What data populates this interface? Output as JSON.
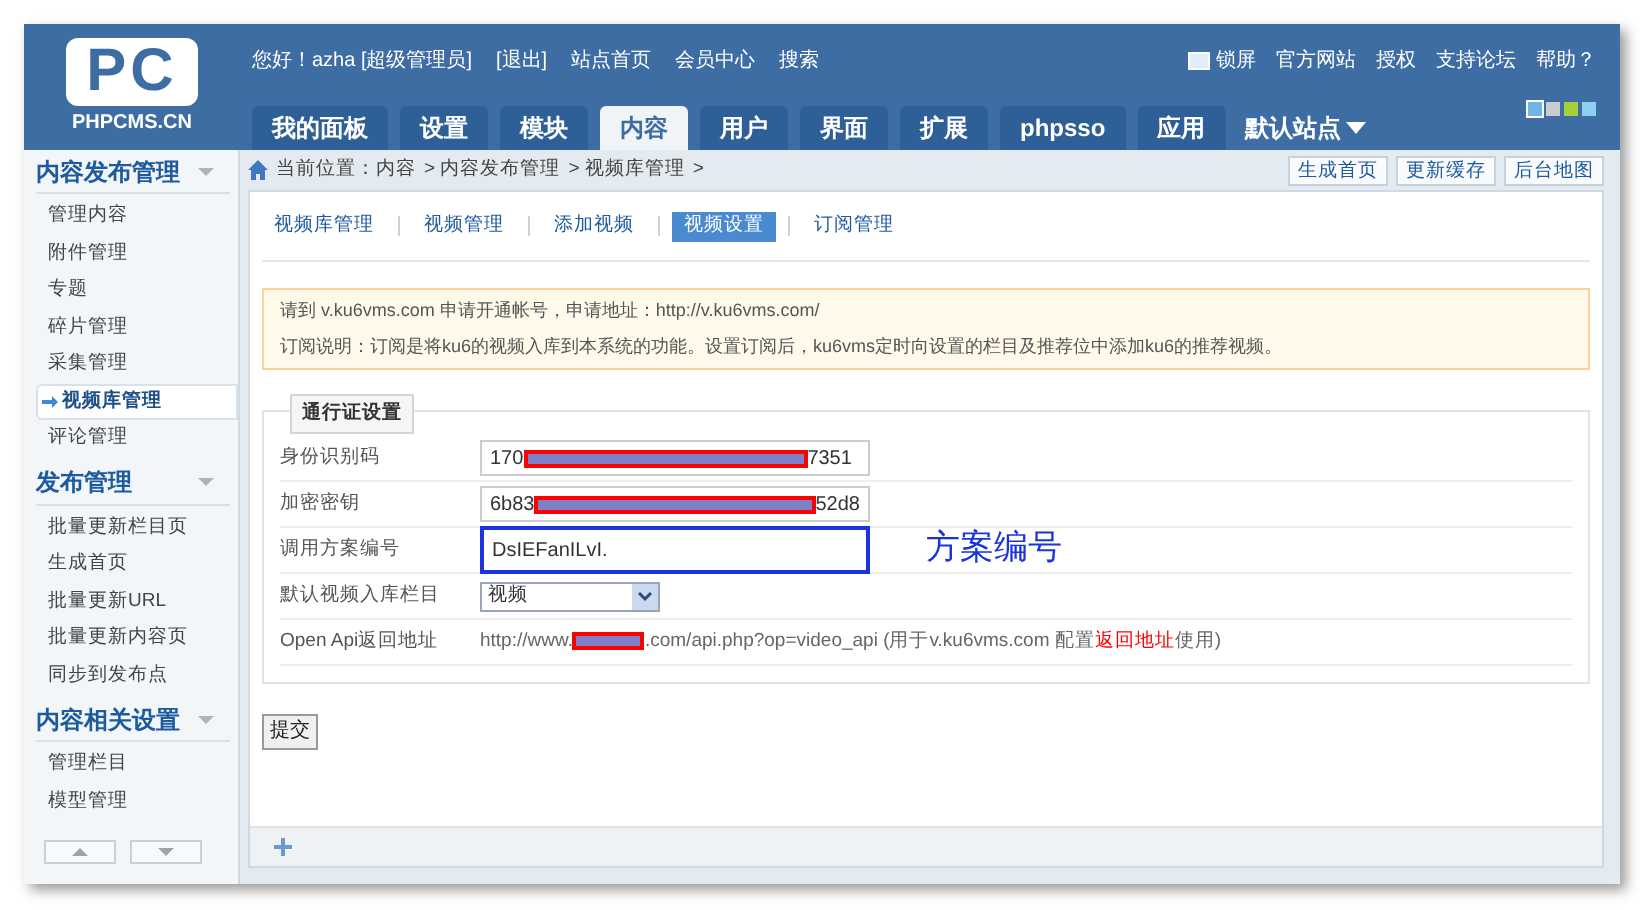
{
  "logo": {
    "letters": "PC",
    "site": "PHPCMS.CN"
  },
  "top_links": [
    "您好！azha [超级管理员]",
    "[退出]",
    "站点首页",
    "会员中心",
    "搜索"
  ],
  "right_links": [
    "锁屏",
    "官方网站",
    "授权",
    "支持论坛",
    "帮助？"
  ],
  "tabs": [
    {
      "label": "我的面板",
      "selected": false
    },
    {
      "label": "设置",
      "selected": false
    },
    {
      "label": "模块",
      "selected": false
    },
    {
      "label": "内容",
      "selected": true
    },
    {
      "label": "用户",
      "selected": false
    },
    {
      "label": "界面",
      "selected": false
    },
    {
      "label": "扩展",
      "selected": false
    },
    {
      "label": "phpsso",
      "selected": false
    },
    {
      "label": "应用",
      "selected": false
    }
  ],
  "site_menu": "默认站点",
  "themes": [
    {
      "color": "#6fb3e8",
      "selected": true
    },
    {
      "color": "#c9cdd2",
      "selected": false
    },
    {
      "color": "#a6cf3c",
      "selected": false
    },
    {
      "color": "#8fd0f0",
      "selected": false
    }
  ],
  "sidebar": [
    {
      "title": "内容发布管理",
      "items": [
        {
          "label": "管理内容",
          "selected": false
        },
        {
          "label": "附件管理",
          "selected": false
        },
        {
          "label": "专题",
          "selected": false
        },
        {
          "label": "碎片管理",
          "selected": false
        },
        {
          "label": "采集管理",
          "selected": false
        },
        {
          "label": "视频库管理",
          "selected": true
        },
        {
          "label": "评论管理",
          "selected": false
        }
      ]
    },
    {
      "title": "发布管理",
      "items": [
        {
          "label": "批量更新栏目页",
          "selected": false
        },
        {
          "label": "生成首页",
          "selected": false
        },
        {
          "label": "批量更新URL",
          "selected": false
        },
        {
          "label": "批量更新内容页",
          "selected": false
        },
        {
          "label": "同步到发布点",
          "selected": false
        }
      ]
    },
    {
      "title": "内容相关设置",
      "items": [
        {
          "label": "管理栏目",
          "selected": false
        },
        {
          "label": "模型管理",
          "selected": false
        }
      ]
    }
  ],
  "breadcrumb": [
    "当前位置：内容",
    "> 内容发布管理",
    "> 视频库管理",
    "> "
  ],
  "header_buttons": [
    "生成首页",
    "更新缓存",
    "后台地图"
  ],
  "subtabs": [
    {
      "label": "视频库管理",
      "selected": false
    },
    {
      "label": "视频管理",
      "selected": false
    },
    {
      "label": "添加视频",
      "selected": false
    },
    {
      "label": "视频设置",
      "selected": true
    },
    {
      "label": "订阅管理",
      "selected": false
    }
  ],
  "notice": [
    "请到 v.ku6vms.com 申请开通帐号，申请地址：http://v.ku6vms.com/",
    "订阅说明：订阅是将ku6的视频入库到本系统的功能。设置订阅后，ku6vms定时向设置的栏目及推荐位中添加ku6的推荐视频。"
  ],
  "fieldset": {
    "legend": "通行证设置",
    "rows": [
      {
        "kind": "input",
        "label": "身份识别码",
        "value_start": "170",
        "value_end": "7351",
        "redacted": true,
        "outlined": false
      },
      {
        "kind": "input",
        "label": "加密密钥",
        "value_start": "6b83",
        "value_end": "52d8",
        "redacted": true,
        "outlined": false
      },
      {
        "kind": "input",
        "label": "调用方案编号",
        "value_start": "DsIEFanILvI.",
        "redacted": false,
        "outlined": true
      },
      {
        "kind": "select",
        "label": "默认视频入库栏目",
        "value": "视频"
      },
      {
        "kind": "url",
        "label": "Open Api返回地址",
        "parts": [
          {
            "text": "http://www.",
            "highlight": false
          },
          {
            "redacted": true
          },
          {
            "text": ".com/api.php?op=video_api (用于v.ku6vms.com 配置",
            "highlight": false
          },
          {
            "text": "返回地址",
            "highlight": true
          },
          {
            "text": "使用)",
            "highlight": false
          }
        ]
      }
    ]
  },
  "annotation": "方案编号",
  "submit": "提交"
}
